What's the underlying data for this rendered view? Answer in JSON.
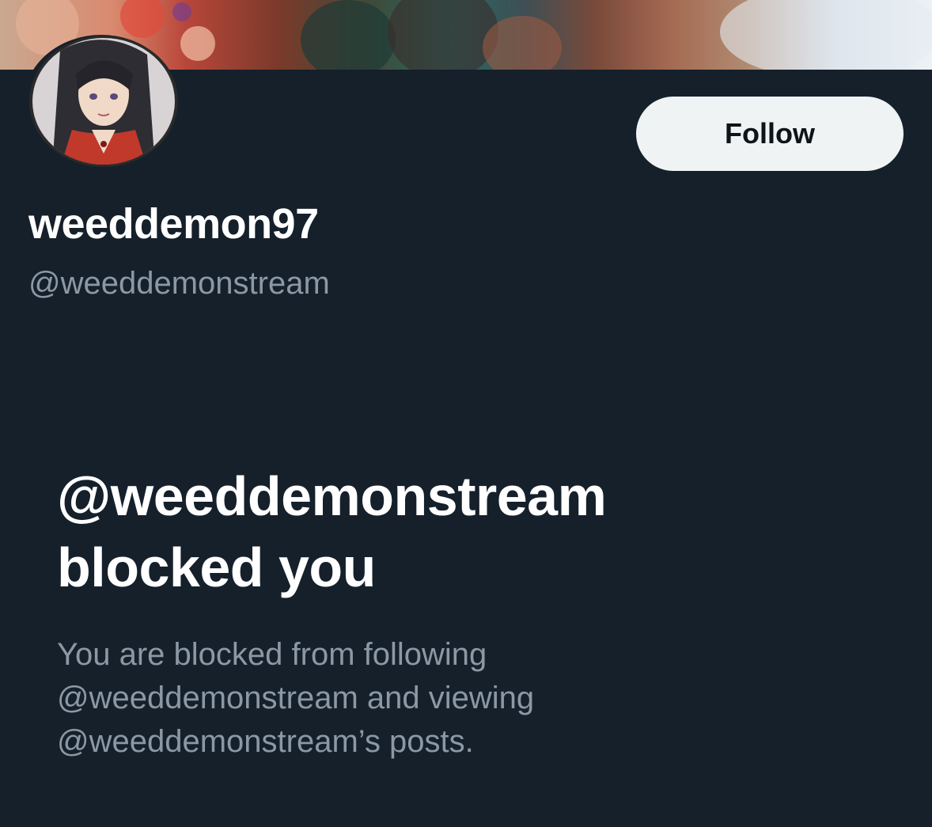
{
  "profile": {
    "display_name": "weeddemon97",
    "handle": "@weeddemonstream"
  },
  "actions": {
    "follow_label": "Follow"
  },
  "blocked": {
    "title_line1": "@weeddemonstream",
    "title_line2": "blocked you",
    "desc_line1": "You are blocked from following",
    "desc_line2": "@weeddemonstream and viewing",
    "desc_line3": "@weeddemonstream’s posts."
  },
  "colors": {
    "background": "#15202b",
    "primary_text": "#ffffff",
    "secondary_text": "#8b98a5",
    "button_bg": "#eff3f4",
    "button_text": "#0f1419"
  }
}
